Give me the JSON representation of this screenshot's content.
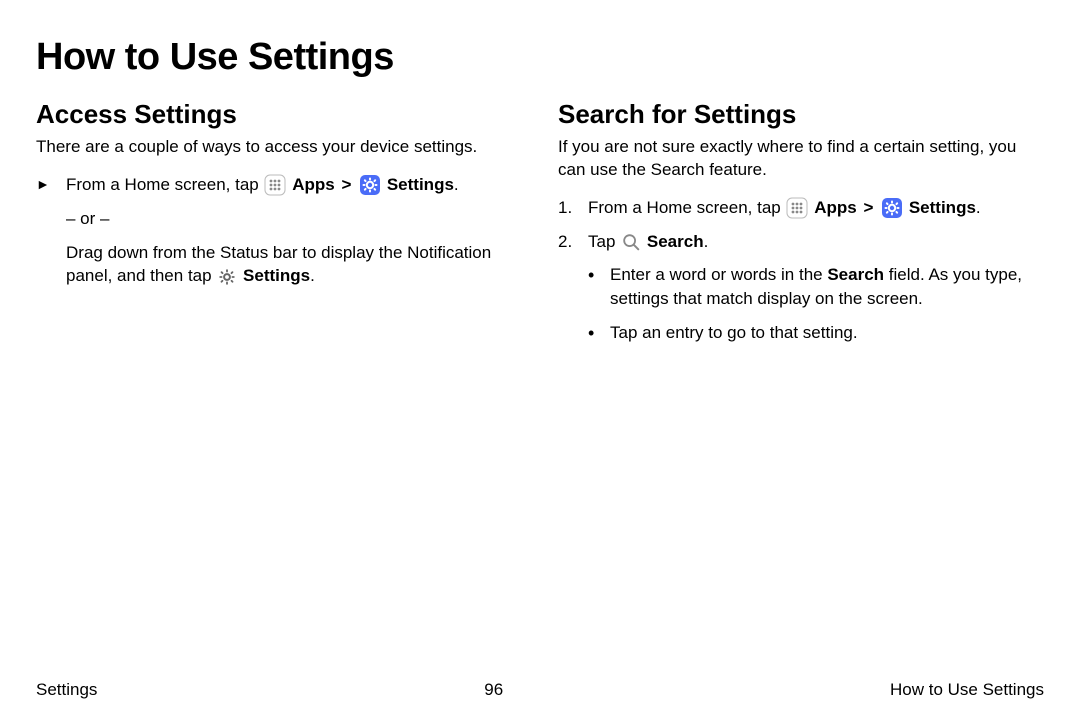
{
  "title": "How to Use Settings",
  "left": {
    "heading": "Access Settings",
    "intro": "There are a couple of ways to access your device settings.",
    "step_marker": "►",
    "step1_a": "From a Home screen, tap ",
    "apps_label": "Apps",
    "sep": ">",
    "settings_label": "Settings",
    "period": ".",
    "or_line": "– or –",
    "drag_a": "Drag down from the Status bar to display the Notification panel, and then tap ",
    "drag_settings": "Settings",
    "drag_period": "."
  },
  "right": {
    "heading": "Search for Settings",
    "intro": "If you are not sure exactly where to find a certain setting, you can use the Search feature.",
    "n1": "1.",
    "step1_a": "From a Home screen, tap ",
    "apps_label": "Apps",
    "sep": ">",
    "settings_label": "Settings",
    "period": ".",
    "n2": "2.",
    "step2_a": "Tap ",
    "search_label": "Search",
    "step2_period": ".",
    "bullet_dot": "•",
    "bullet1_a": "Enter a word or words in the ",
    "bullet1_bold": "Search",
    "bullet1_b": " field. As you type, settings that match display on the screen.",
    "bullet2": "Tap an entry to go to that setting."
  },
  "footer": {
    "left": "Settings",
    "center": "96",
    "right": "How to Use Settings"
  }
}
